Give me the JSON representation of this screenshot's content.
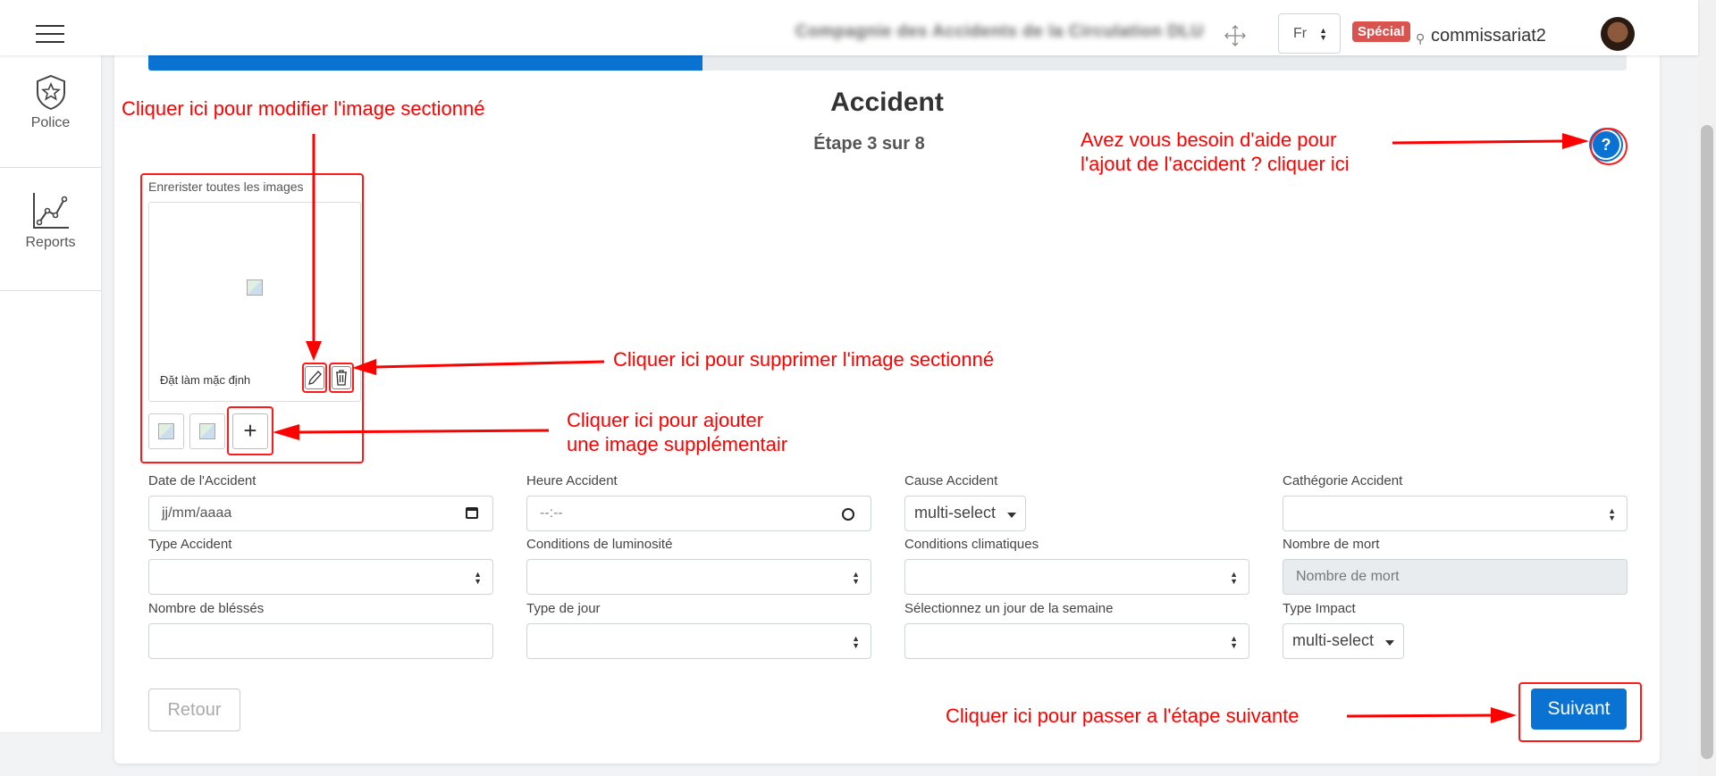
{
  "header": {
    "company": "Compagnie des Accidents de la Circulation DLU",
    "language": "Fr",
    "badge": "Spécial",
    "username": "commissariat2"
  },
  "sidebar": {
    "items": [
      {
        "label": "Police",
        "icon": "police-badge-icon"
      },
      {
        "label": "Reports",
        "icon": "line-chart-icon"
      }
    ]
  },
  "progress": {
    "fraction": 0.375
  },
  "form": {
    "title": "Accident",
    "step": "Étape 3 sur 8",
    "images_label": "Enrerister toutes les images",
    "default_label": "Đặt làm mặc định",
    "fields": {
      "date_label": "Date de l'Accident",
      "date_placeholder": "jj/mm/aaaa",
      "heure_label": "Heure Accident",
      "heure_placeholder": "--:--",
      "cause_label": "Cause Accident",
      "cause_value": "multi-select",
      "categorie_label": "Cathégorie Accident",
      "type_label": "Type Accident",
      "lumi_label": "Conditions de luminosité",
      "clim_label": "Conditions climatiques",
      "morts_label": "Nombre de mort",
      "morts_placeholder": "Nombre de mort",
      "blesses_label": "Nombre de bléssés",
      "jour_type_label": "Type de jour",
      "jour_semaine_label": "Sélectionnez un jour de la semaine",
      "impact_label": "Type Impact",
      "impact_value": "multi-select"
    },
    "buttons": {
      "retour": "Retour",
      "suivant": "Suivant"
    }
  },
  "annotations": {
    "edit": "Cliquer ici pour modifier l'image sectionné",
    "help_line1": "Avez vous besoin d'aide pour",
    "help_line2": "l'ajout de l'accident ? cliquer ici",
    "delete": "Cliquer ici pour supprimer l'image sectionné",
    "add_line1": "Cliquer ici pour ajouter",
    "add_line2": "une image supplémentair",
    "next": "Cliquer ici pour passer a l'étape suivante"
  },
  "colors": {
    "primary": "#0a72d2",
    "annotation": "#ff0000",
    "badge": "#d9534f"
  }
}
